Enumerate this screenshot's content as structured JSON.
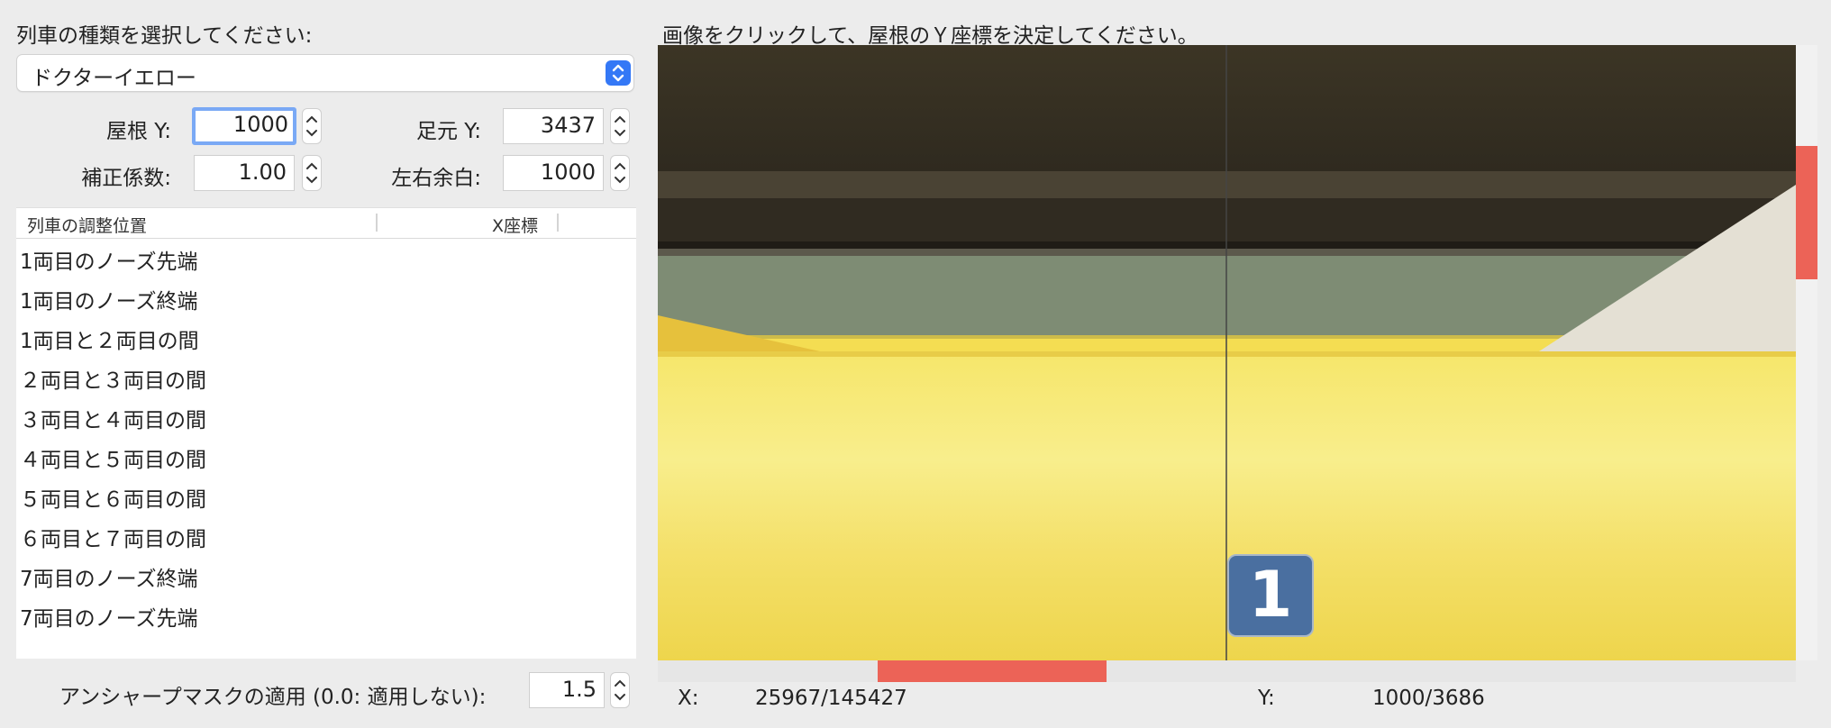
{
  "train_select": {
    "prompt": "列車の種類を選択してください:",
    "selected": "ドクターイエロー"
  },
  "instruction": "画像をクリックして、屋根のＹ座標を決定してください。",
  "fields": {
    "roof_y": {
      "label": "屋根 Y:",
      "value": "1000"
    },
    "foot_y": {
      "label": "足元 Y:",
      "value": "3437"
    },
    "correction": {
      "label": "補正係数:",
      "value": "1.00"
    },
    "margin": {
      "label": "左右余白:",
      "value": "1000"
    }
  },
  "table": {
    "headers": [
      "列車の調整位置",
      "X座標"
    ],
    "rows": [
      "1両目のノーズ先端",
      "1両目のノーズ終端",
      "1両目と２両目の間",
      "２両目と３両目の間",
      "３両目と４両目の間",
      "４両目と５両目の間",
      "５両目と６両目の間",
      "６両目と７両目の間",
      "7両目のノーズ終端",
      "7両目のノーズ先端"
    ]
  },
  "unsharp": {
    "label": "アンシャープマスクの適用 (0.0: 適用しない):",
    "value": "1.5"
  },
  "image": {
    "car_number": "1"
  },
  "status": {
    "x_label": "X:",
    "x_value": "25967/145427",
    "y_label": "Y:",
    "y_value": "1000/3686"
  },
  "colors": {
    "accent": "#3478f6",
    "scroll_thumb": "#ec6357",
    "train_yellow": "#f4dd52",
    "badge_blue": "#4a6fa0"
  },
  "icons": [
    "select-chevron-icon",
    "stepper-up-icon",
    "stepper-down-icon"
  ]
}
